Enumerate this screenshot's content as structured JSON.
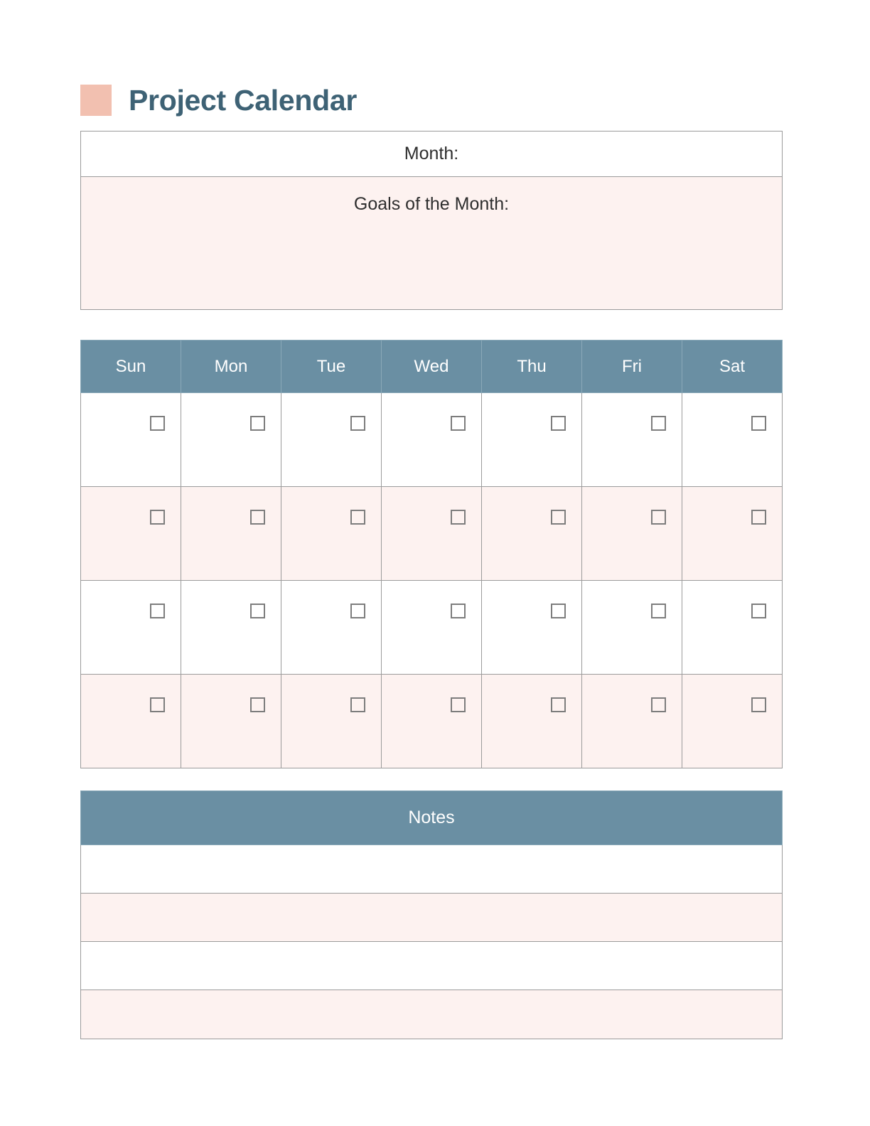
{
  "document": {
    "title": "Project Calendar",
    "accent_square_color": "#F2C0B0",
    "title_color": "#3E6275"
  },
  "theme": {
    "header_blue": "#6A8FA3",
    "row_pink": "#FDF2F0",
    "row_white": "#FFFFFF",
    "border_gray": "#9B9B9B",
    "checkbox_gray": "#7D7D7D",
    "text_dark": "#2E2E2E"
  },
  "month_section": {
    "month_label": "Month:",
    "goals_label": "Goals of the Month:"
  },
  "calendar": {
    "day_headers": [
      "Sun",
      "Mon",
      "Tue",
      "Wed",
      "Thu",
      "Fri",
      "Sat"
    ],
    "week_rows": [
      {
        "shade": "white",
        "cells": [
          {
            "checkbox": true
          },
          {
            "checkbox": true
          },
          {
            "checkbox": true
          },
          {
            "checkbox": true
          },
          {
            "checkbox": true
          },
          {
            "checkbox": true
          },
          {
            "checkbox": true
          }
        ]
      },
      {
        "shade": "pink",
        "cells": [
          {
            "checkbox": true
          },
          {
            "checkbox": true
          },
          {
            "checkbox": true
          },
          {
            "checkbox": true
          },
          {
            "checkbox": true
          },
          {
            "checkbox": true
          },
          {
            "checkbox": true
          }
        ]
      },
      {
        "shade": "white",
        "cells": [
          {
            "checkbox": true
          },
          {
            "checkbox": true
          },
          {
            "checkbox": true
          },
          {
            "checkbox": true
          },
          {
            "checkbox": true
          },
          {
            "checkbox": true
          },
          {
            "checkbox": true
          }
        ]
      },
      {
        "shade": "pink",
        "cells": [
          {
            "checkbox": true
          },
          {
            "checkbox": true
          },
          {
            "checkbox": true
          },
          {
            "checkbox": true
          },
          {
            "checkbox": true
          },
          {
            "checkbox": true
          },
          {
            "checkbox": true
          }
        ]
      }
    ]
  },
  "notes": {
    "header_label": "Notes",
    "lines": [
      {
        "shade": "white",
        "value": ""
      },
      {
        "shade": "pink",
        "value": ""
      },
      {
        "shade": "white",
        "value": ""
      },
      {
        "shade": "pink",
        "value": ""
      }
    ]
  }
}
